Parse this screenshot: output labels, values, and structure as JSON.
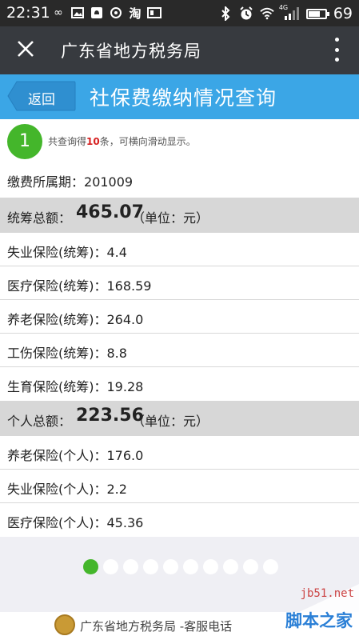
{
  "status_bar": {
    "time": "22:31",
    "battery": "69",
    "battery_level_percent": 69,
    "network_label": "4G",
    "icons": [
      "infinity-icon",
      "image-icon",
      "notification-icon",
      "refresh-icon",
      "taobao-icon",
      "storage-icon",
      "bluetooth-icon",
      "alarm-icon",
      "wifi-icon",
      "signal-icon",
      "battery-icon"
    ]
  },
  "title_bar": {
    "title": "广东省地方税务局",
    "close_icon": "close-icon",
    "menu_icon": "more-vertical-icon"
  },
  "header": {
    "back_label": "返回",
    "page_title": "社保费缴纳情况查询",
    "color": "#3ba6e6"
  },
  "summary": {
    "badge": "1",
    "notice_prefix": "共查询得",
    "notice_count": "10",
    "notice_suffix": "条，可横向滑动显示。"
  },
  "period": {
    "label": "缴费所属期：",
    "value": "201009"
  },
  "pooled_total": {
    "label": "统筹总额：",
    "value": "465.07",
    "unit": "（单位：元）"
  },
  "pooled_items": [
    {
      "label": "失业保险(统筹)：",
      "value": "4.4"
    },
    {
      "label": "医疗保险(统筹)：",
      "value": "168.59"
    },
    {
      "label": "养老保险(统筹)：",
      "value": "264.0"
    },
    {
      "label": "工伤保险(统筹)：",
      "value": "8.8"
    },
    {
      "label": "生育保险(统筹)：",
      "value": "19.28"
    }
  ],
  "personal_total": {
    "label": "个人总额：",
    "value": "223.56",
    "unit": "（单位：元）"
  },
  "personal_items": [
    {
      "label": "养老保险(个人)：",
      "value": "176.0"
    },
    {
      "label": "失业保险(个人)：",
      "value": "2.2"
    },
    {
      "label": "医疗保险(个人)：",
      "value": "45.36"
    }
  ],
  "pager": {
    "total_pages": 10,
    "active_page": 1,
    "active_color": "#44b62b"
  },
  "footer": {
    "text": "广东省地方税务局 -客服电话"
  },
  "watermark": {
    "site": "jb51.net",
    "name": "脚本之家"
  }
}
